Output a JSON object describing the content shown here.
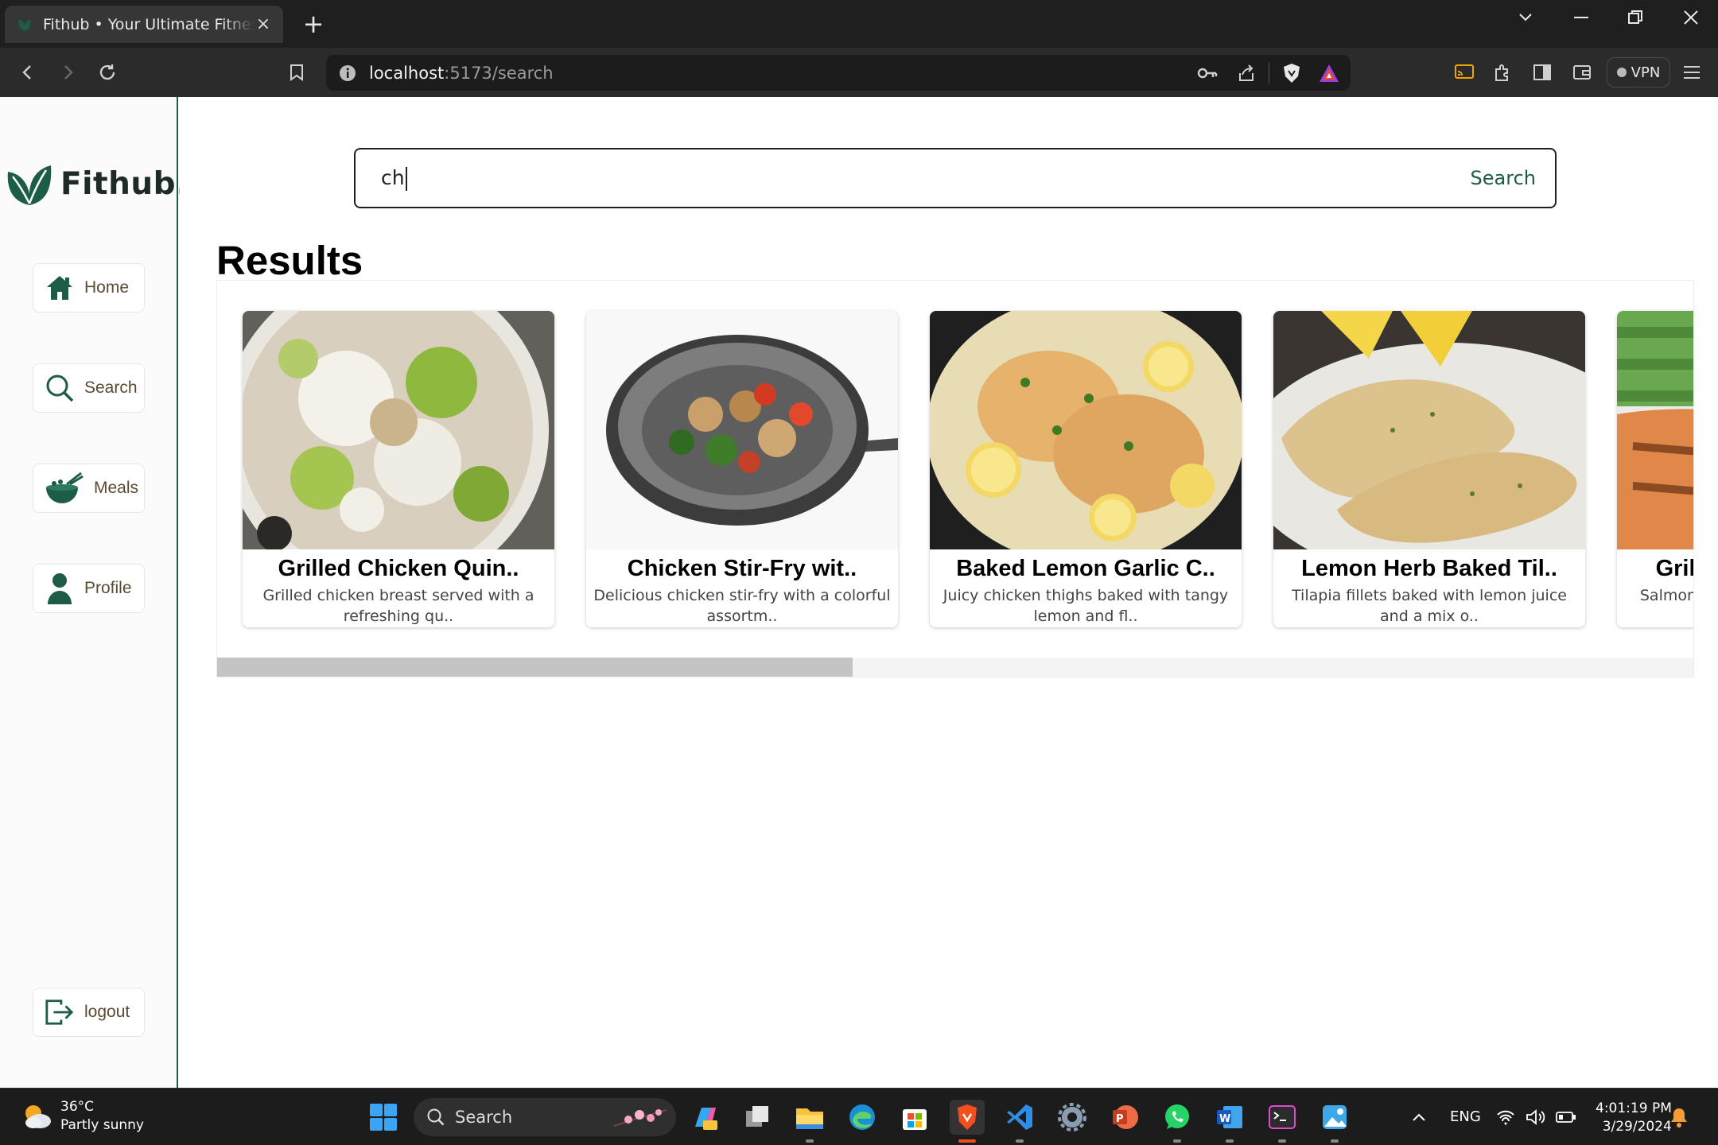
{
  "browser": {
    "tab_title": "Fithub • Your Ultimate Fitness Companion",
    "url_host": "localhost",
    "url_path": ":5173/search",
    "vpn_label": "VPN",
    "icons": [
      "back-icon",
      "forward-icon",
      "reload-icon",
      "bookmark-icon",
      "info-icon",
      "key-icon",
      "share-icon",
      "brave-shields-icon",
      "brave-rewards-icon",
      "cast-icon",
      "extensions-icon",
      "sidebar-icon",
      "wallet-icon",
      "menu-icon"
    ]
  },
  "app": {
    "logo_text": "Fithub",
    "logo_dot": ".",
    "brand_color": "#1d5c47",
    "accent_color": "#e8a33b",
    "nav": [
      {
        "label": "Home",
        "icon": "home-icon"
      },
      {
        "label": "Search",
        "icon": "search-icon"
      },
      {
        "label": "Meals",
        "icon": "bowl-icon"
      },
      {
        "label": "Profile",
        "icon": "user-icon"
      }
    ],
    "logout_label": "logout"
  },
  "search": {
    "value": "ch",
    "button_label": "Search"
  },
  "results": {
    "title": "Results",
    "scroll_fraction": 0.43,
    "cards": [
      {
        "title": "Grilled Chicken Quin..",
        "desc": "Grilled chicken breast served with a refreshing qu.."
      },
      {
        "title": "Chicken Stir-Fry wit..",
        "desc": "Delicious chicken stir-fry with a colorful assortm.."
      },
      {
        "title": "Baked Lemon Garlic C..",
        "desc": "Juicy chicken thighs baked with tangy lemon and fl.."
      },
      {
        "title": "Lemon Herb Baked Til..",
        "desc": "Tilapia fillets baked with lemon juice and a mix o.."
      },
      {
        "title": "Grilled Salmon with ..",
        "desc": "Salmon fillets grilled to perfection.."
      }
    ]
  },
  "taskbar": {
    "temperature": "36°C",
    "weather": "Partly sunny",
    "search_label": "Search",
    "language": "ENG",
    "time": "4:01:19 PM",
    "date": "3/29/2024"
  }
}
